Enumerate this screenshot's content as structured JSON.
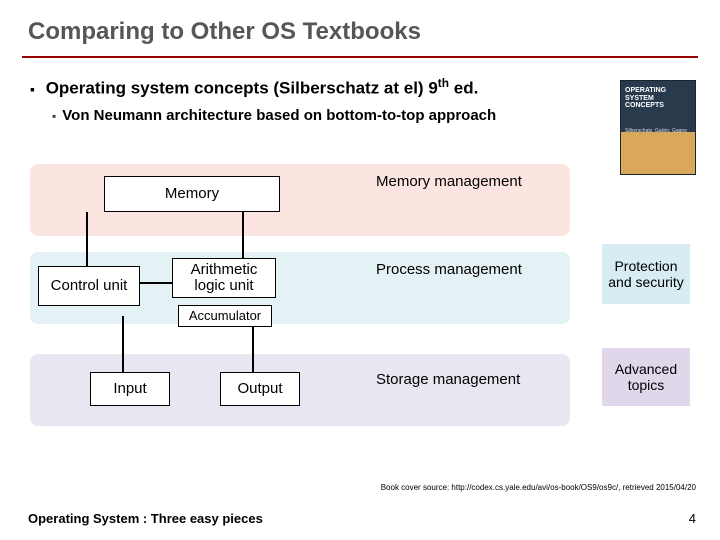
{
  "title": "Comparing to Other OS Textbooks",
  "bullet1_pre": "Operating system concepts (Silberschatz at el) 9",
  "bullet1_sup": "th",
  "bullet1_post": " ed.",
  "bullet2": "Von Neumann architecture based on bottom-to-top approach",
  "diagram": {
    "memory": "Memory",
    "control_unit": "Control unit",
    "alu": "Arithmetic logic unit",
    "accumulator": "Accumulator",
    "input": "Input",
    "output": "Output",
    "band1_label": "Memory management",
    "band2_label": "Process management",
    "band3_label": "Storage management",
    "side1": "Protection and security",
    "side2": "Advanced topics"
  },
  "cover_title": "OPERATING SYSTEM CONCEPTS",
  "cover_authors": "Silberschatz, Galvin, Gagne",
  "source_note": "Book cover source: http://codex.cs.yale.edu/avi/os-book/OS9/os9c/, retrieved 2015/04/20",
  "footer_left": "Operating System : Three easy pieces",
  "page_number": "4"
}
